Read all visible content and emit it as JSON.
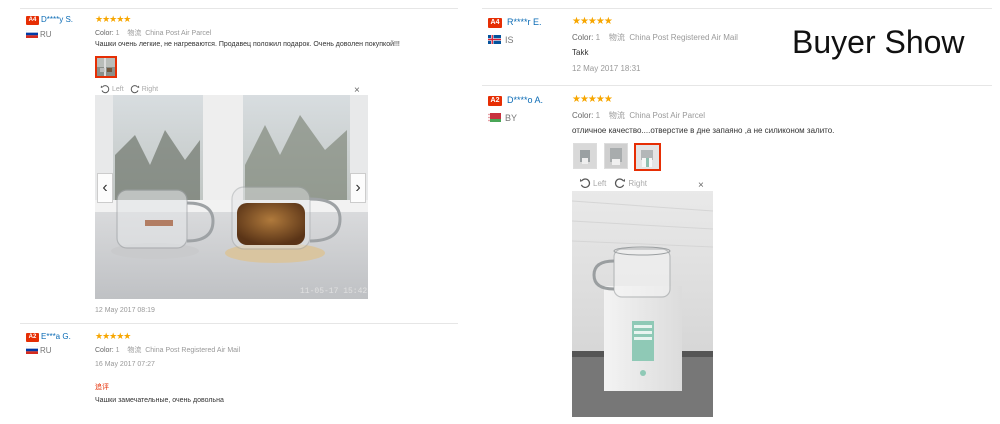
{
  "banner": {
    "label": "Buyer Show"
  },
  "viewer": {
    "left_label": "Left",
    "right_label": "Right",
    "close_symbol": "×",
    "prev_symbol": "‹",
    "next_symbol": "›"
  },
  "photo_timestamp": "11-05-17 15:42",
  "left_column": {
    "reviews": [
      {
        "badge": "A4",
        "name": "D****y S.",
        "country": "RU",
        "stars": "★★★★★",
        "color_label": "Color:",
        "color_value": "1",
        "shipping_label": "物流",
        "shipping_value": "China Post Air Parcel",
        "text": "Чашки очень легкие, не нагреваются. Продавец положил подарок. Очень доволен покупкой!!!",
        "date": "12 May 2017 08:19"
      },
      {
        "badge": "A2",
        "name": "E***a G.",
        "country": "RU",
        "stars": "★★★★★",
        "color_label": "Color:",
        "color_value": "1",
        "shipping_label": "物流",
        "shipping_value": "China Post Registered Air Mail",
        "date": "16 May 2017 07:27",
        "followup_label": "追评",
        "followup_text": "Чашки замечательные, очень довольна"
      }
    ]
  },
  "right_column": {
    "reviews": [
      {
        "badge": "A4",
        "name": "R****r E.",
        "country": "IS",
        "stars": "★★★★★",
        "color_label": "Color:",
        "color_value": "1",
        "shipping_label": "物流",
        "shipping_value": "China Post Registered Air Mail",
        "text": "Takk",
        "date": "12 May 2017 18:31"
      },
      {
        "badge": "A2",
        "name": "D****o A.",
        "country": "BY",
        "stars": "★★★★★",
        "color_label": "Color:",
        "color_value": "1",
        "shipping_label": "物流",
        "shipping_value": "China Post Air Parcel",
        "text": "отличное качество....отверстие в дне запаяно ,а не силиконом залито."
      }
    ]
  },
  "colors": {
    "accent": "#e62e04",
    "link": "#0b6bb5",
    "star": "#f7a600"
  }
}
